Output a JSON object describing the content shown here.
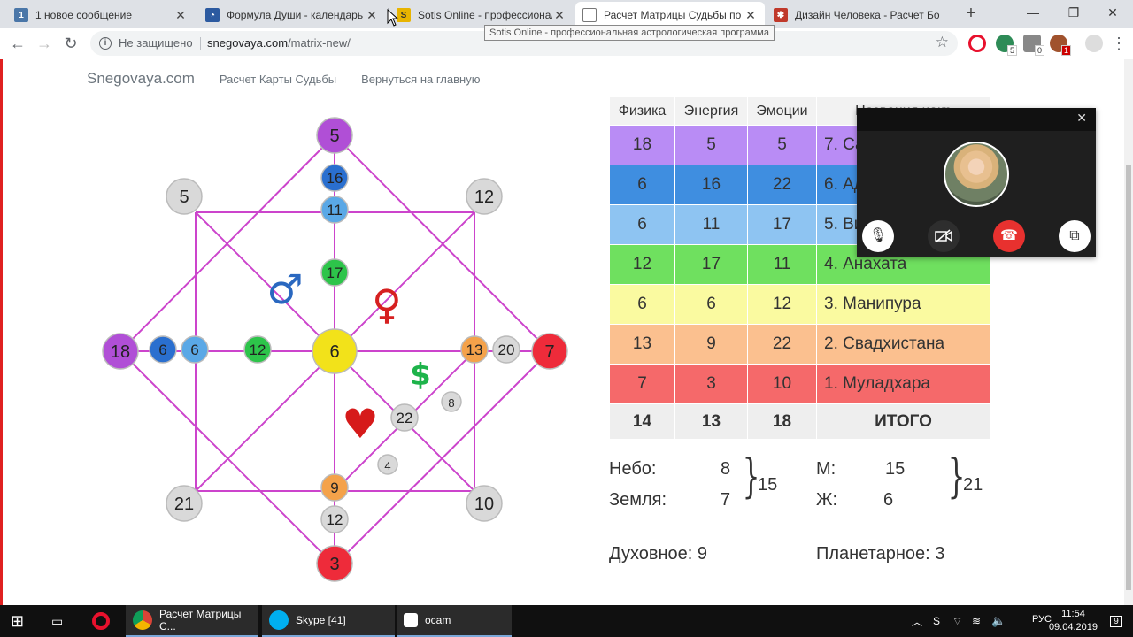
{
  "tabs": [
    {
      "title": "1 новое сообщение",
      "icon": "vk-icon",
      "active": false
    },
    {
      "title": "Формула Души - календарь",
      "icon": "calendar-site-icon",
      "active": false
    },
    {
      "title": "Sotis Online - профессиональ",
      "icon": "sotis-icon",
      "active": false
    },
    {
      "title": "Расчет Матрицы Судьбы по М",
      "icon": "document-icon",
      "active": true
    },
    {
      "title": "Дизайн Человека - Расчет Бо",
      "icon": "design-icon",
      "active": false
    }
  ],
  "tooltip": "Sotis Online - профессиональная астрологическая программа",
  "address": {
    "security": "Не защищено",
    "host": "snegovaya.com",
    "path": "/matrix-new/"
  },
  "extensions": [
    {
      "name": "opera-icon",
      "badge": ""
    },
    {
      "name": "shield-icon",
      "badge": "5"
    },
    {
      "name": "puzzle-icon",
      "badge": "0"
    },
    {
      "name": "badge-icon",
      "badge": "1"
    }
  ],
  "site_nav": {
    "brand": "Snegovaya.com",
    "links": [
      "Расчет Карты Судьбы",
      "Вернуться на главную"
    ]
  },
  "matrix": {
    "nodes": [
      {
        "id": "top",
        "value": "5",
        "color": "#b04fd6"
      },
      {
        "id": "top-inner-1",
        "value": "16",
        "color": "#2a6fcf"
      },
      {
        "id": "top-inner-2",
        "value": "11",
        "color": "#5aa8e6"
      },
      {
        "id": "center-top",
        "value": "17",
        "color": "#2dc44a"
      },
      {
        "id": "left",
        "value": "18",
        "color": "#b04fd6"
      },
      {
        "id": "left-inner-1",
        "value": "6",
        "color": "#2a6fcf"
      },
      {
        "id": "left-inner-2",
        "value": "6",
        "color": "#5aa8e6"
      },
      {
        "id": "center-left",
        "value": "12",
        "color": "#2dc44a"
      },
      {
        "id": "center",
        "value": "6",
        "color": "#f2e21a"
      },
      {
        "id": "right-inner-2",
        "value": "13",
        "color": "#f4a24a"
      },
      {
        "id": "right-inner-1",
        "value": "20",
        "color": "#d9d9d9"
      },
      {
        "id": "right",
        "value": "7",
        "color": "#ee2b3a"
      },
      {
        "id": "bottom-inner-2",
        "value": "9",
        "color": "#f4a24a"
      },
      {
        "id": "bottom-inner-1",
        "value": "12",
        "color": "#d9d9d9"
      },
      {
        "id": "bottom",
        "value": "3",
        "color": "#ee2b3a"
      },
      {
        "id": "corner-tl",
        "value": "5",
        "color": "#d9d9d9"
      },
      {
        "id": "corner-tr",
        "value": "12",
        "color": "#d9d9d9"
      },
      {
        "id": "corner-bl",
        "value": "21",
        "color": "#d9d9d9"
      },
      {
        "id": "corner-br",
        "value": "10",
        "color": "#d9d9d9"
      },
      {
        "id": "money-center",
        "value": "22",
        "color": "#d9d9d9"
      },
      {
        "id": "money-upper",
        "value": "8",
        "color": "#d9d9d9"
      },
      {
        "id": "money-lower",
        "value": "4",
        "color": "#d9d9d9"
      }
    ],
    "symbols": {
      "male": "♂",
      "female": "♀",
      "money": "$",
      "heart": "♥"
    },
    "line_color": "#cc44cc"
  },
  "table": {
    "headers": [
      "Физика",
      "Энергия",
      "Эмоции",
      "Названия чакр"
    ],
    "rows": [
      {
        "cells": [
          "18",
          "5",
          "5",
          "7. Сахасрара"
        ],
        "color": "#b98cf5"
      },
      {
        "cells": [
          "6",
          "16",
          "22",
          "6. Аджна"
        ],
        "color": "#3f8ee0"
      },
      {
        "cells": [
          "6",
          "11",
          "17",
          "5. Вишудха"
        ],
        "color": "#8ec4f2"
      },
      {
        "cells": [
          "12",
          "17",
          "11",
          "4. Анахата"
        ],
        "color": "#6fe05f"
      },
      {
        "cells": [
          "6",
          "6",
          "12",
          "3. Манипура"
        ],
        "color": "#fafaa0"
      },
      {
        "cells": [
          "13",
          "9",
          "22",
          "2. Свадхистана"
        ],
        "color": "#fbc08f"
      },
      {
        "cells": [
          "7",
          "3",
          "10",
          "1. Муладхара"
        ],
        "color": "#f5696a"
      }
    ],
    "total": [
      "14",
      "13",
      "18",
      "ИТОГО"
    ]
  },
  "summary": {
    "sky_label": "Небо:",
    "sky_value": "8",
    "earth_label": "Земля:",
    "earth_value": "7",
    "sky_earth_sum": "15",
    "m_label": "М:",
    "m_value": "15",
    "f_label": "Ж:",
    "f_value": "6",
    "mf_sum": "21",
    "spiritual": "Духовное: 9",
    "planetary": "Планетарное: 3"
  },
  "skype_call": {
    "buttons": [
      "microphone-icon",
      "video-off-icon",
      "hang-up-icon",
      "minimize-window-icon"
    ]
  },
  "taskbar": {
    "apps": [
      {
        "label": "Расчет Матрицы С...",
        "icon": "chrome-icon"
      },
      {
        "label": "Skype [41]",
        "icon": "skype-icon"
      },
      {
        "label": "ocam",
        "icon": "ocam-icon"
      }
    ],
    "language": "РУС",
    "time": "11:54",
    "date": "09.04.2019",
    "notifications": "9"
  }
}
